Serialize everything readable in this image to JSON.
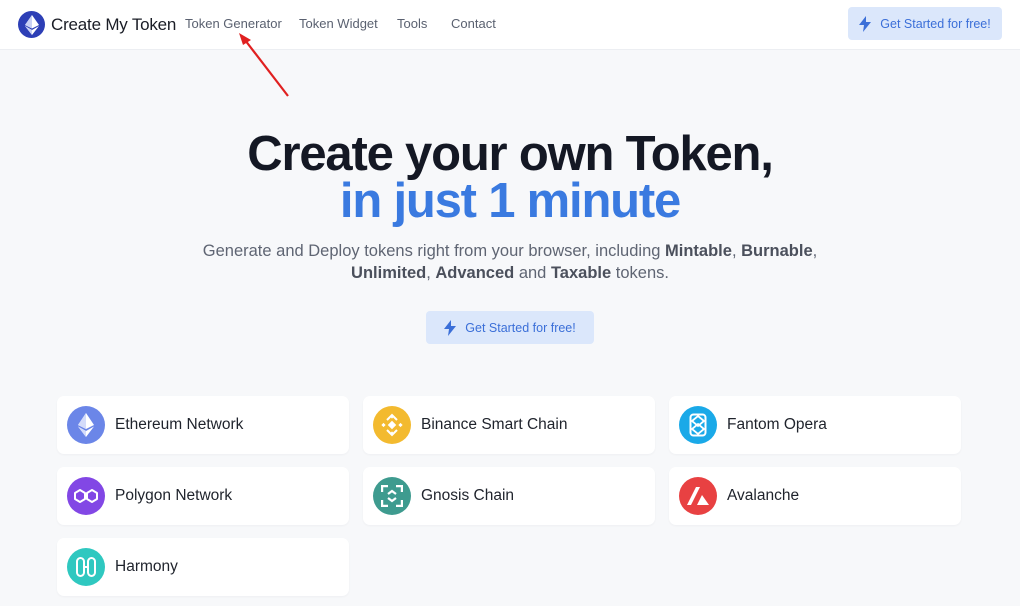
{
  "brand": {
    "name": "Create My Token",
    "logo_icon": "ethereum-logo-icon"
  },
  "nav": {
    "links": [
      "Token Generator",
      "Token Widget",
      "Tools",
      "Contact"
    ],
    "cta_label": "Get Started for free!",
    "cta_icon": "lightning-bolt-icon"
  },
  "hero": {
    "title_line1": "Create your own Token,",
    "title_line2": "in just 1 minute",
    "subtitle": {
      "part1": "Generate and Deploy tokens right from your browser, including ",
      "bold1": "Mintable",
      "sep1": ", ",
      "bold2": "Burnable",
      "sep2": ",",
      "bold3": "Unlimited",
      "sep3": ", ",
      "bold4": "Advanced",
      "part2": " and ",
      "bold5": "Taxable",
      "part3": " tokens."
    },
    "cta_label": "Get Started for free!"
  },
  "networks": [
    {
      "label": "Ethereum Network",
      "icon": "ethereum-icon",
      "color": "#6b86e8"
    },
    {
      "label": "Binance Smart Chain",
      "icon": "binance-icon",
      "color": "#f3ba2f"
    },
    {
      "label": "Fantom Opera",
      "icon": "fantom-icon",
      "color": "#1aa9e8"
    },
    {
      "label": "Polygon Network",
      "icon": "polygon-icon",
      "color": "#8247e5"
    },
    {
      "label": "Gnosis Chain",
      "icon": "gnosis-icon",
      "color": "#3e9b8f"
    },
    {
      "label": "Avalanche",
      "icon": "avalanche-icon",
      "color": "#e84142"
    },
    {
      "label": "Harmony",
      "icon": "harmony-icon",
      "color": "#2fc8c0"
    }
  ],
  "colors": {
    "accent": "#3a7ae0",
    "cta_bg": "#dbe7fb",
    "annotation_arrow": "#e02020"
  }
}
